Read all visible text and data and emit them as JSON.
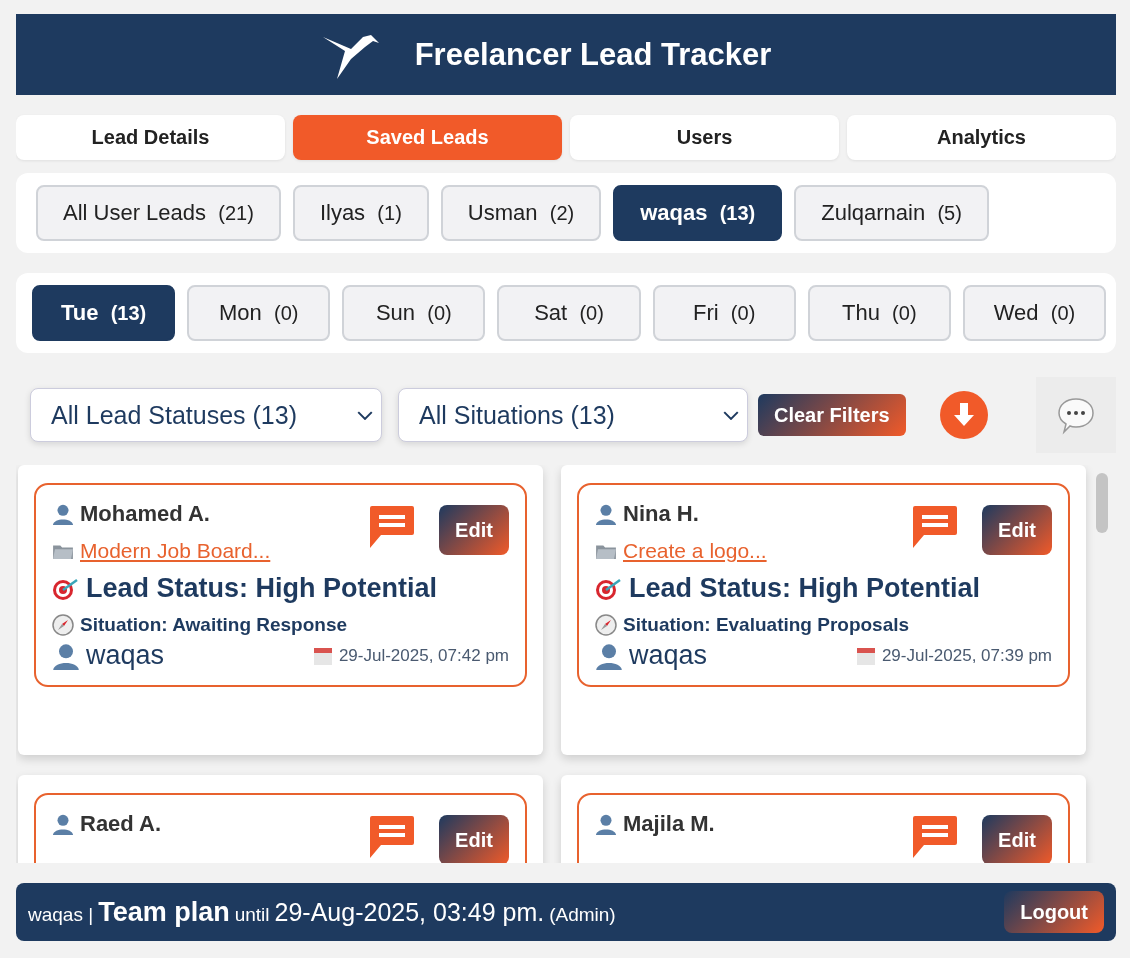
{
  "header": {
    "title": "Freelancer Lead Tracker"
  },
  "tabs": [
    {
      "label": "Lead Details",
      "selected": false
    },
    {
      "label": "Saved Leads",
      "selected": true
    },
    {
      "label": "Users",
      "selected": false
    },
    {
      "label": "Analytics",
      "selected": false
    }
  ],
  "users": [
    {
      "label": "All User Leads",
      "count": "(21)",
      "selected": false
    },
    {
      "label": "Ilyas",
      "count": "(1)",
      "selected": false
    },
    {
      "label": "Usman",
      "count": "(2)",
      "selected": false
    },
    {
      "label": "waqas",
      "count": "(13)",
      "selected": true
    },
    {
      "label": "Zulqarnain",
      "count": "(5)",
      "selected": false
    }
  ],
  "days": [
    {
      "label": "Tue",
      "count": "(13)",
      "selected": true
    },
    {
      "label": "Mon",
      "count": "(0)",
      "selected": false
    },
    {
      "label": "Sun",
      "count": "(0)",
      "selected": false
    },
    {
      "label": "Sat",
      "count": "(0)",
      "selected": false
    },
    {
      "label": "Fri",
      "count": "(0)",
      "selected": false
    },
    {
      "label": "Thu",
      "count": "(0)",
      "selected": false
    },
    {
      "label": "Wed",
      "count": "(0)",
      "selected": false
    }
  ],
  "filters": {
    "status": "All Lead Statuses (13)",
    "situation": "All Situations (13)",
    "clear": "Clear Filters"
  },
  "leads": [
    {
      "name": "Mohamed A.",
      "project": "Modern Job Board...",
      "status": "Lead Status: High Potential",
      "situation": "Situation: Awaiting Response",
      "owner": "waqas",
      "date": "29-Jul-2025, 07:42 pm",
      "edit": "Edit"
    },
    {
      "name": "Nina H.",
      "project": "Create a logo...",
      "status": "Lead Status: High Potential",
      "situation": "Situation: Evaluating Proposals",
      "owner": "waqas",
      "date": "29-Jul-2025, 07:39 pm",
      "edit": "Edit"
    },
    {
      "name": "Raed A.",
      "edit": "Edit"
    },
    {
      "name": "Majila M.",
      "edit": "Edit"
    }
  ],
  "footer": {
    "user": "waqas |",
    "plan": "Team plan",
    "until": "until",
    "date": "29-Aug-2025, 03:49 pm.",
    "role": "(Admin)",
    "logout": "Logout"
  }
}
